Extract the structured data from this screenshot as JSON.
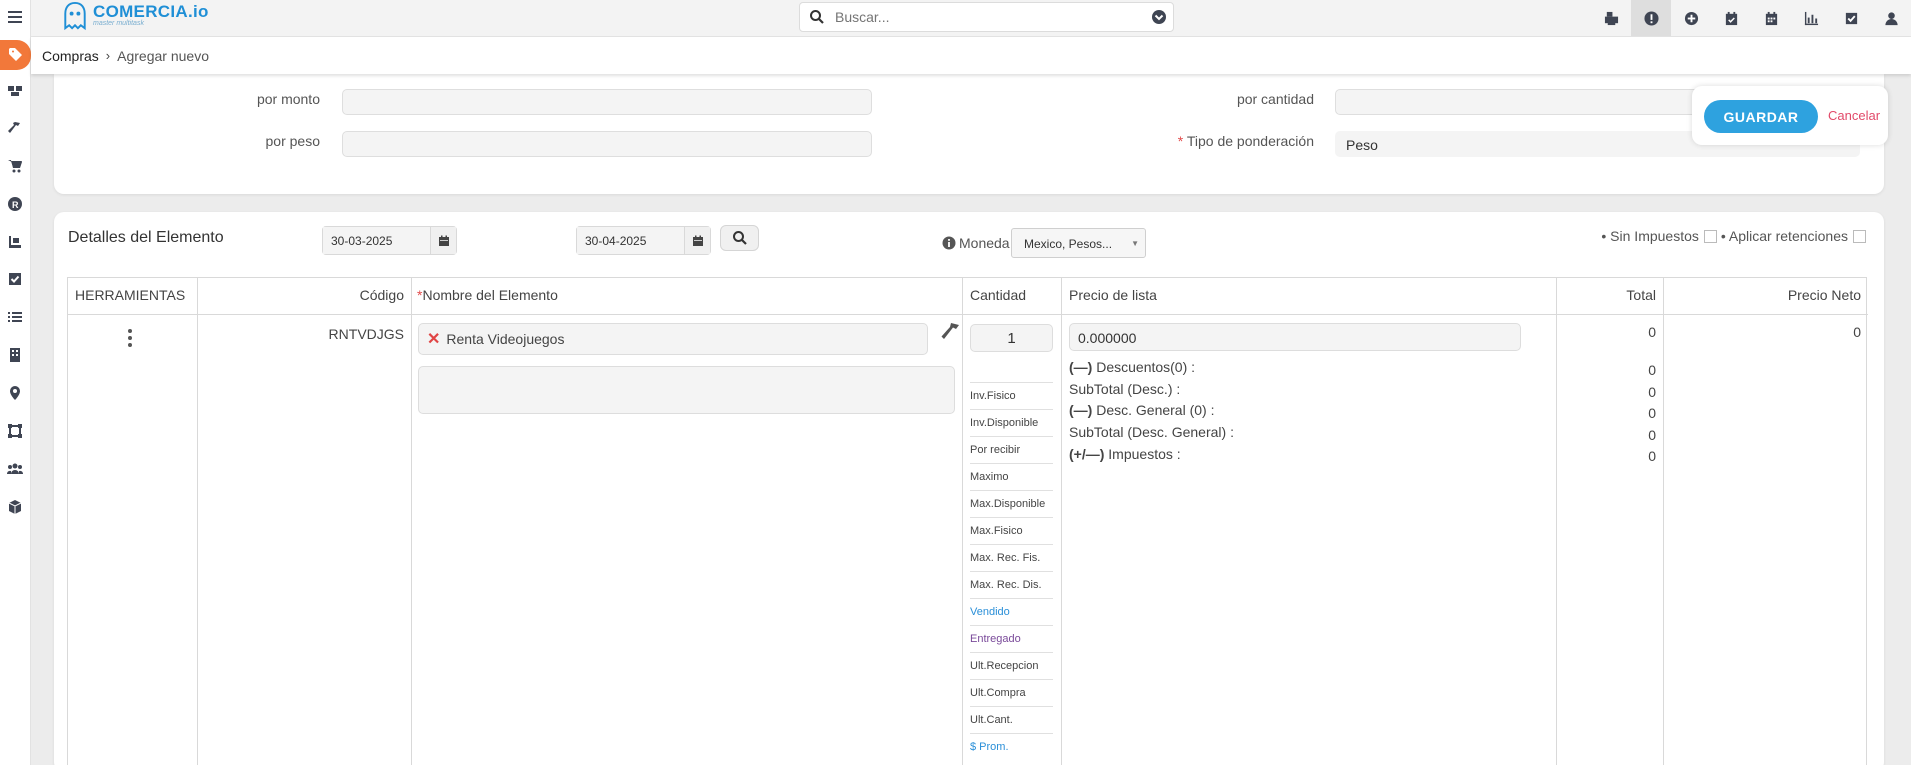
{
  "app": {
    "brand": "COMERCIA.io",
    "tagline": "master multitask"
  },
  "search": {
    "placeholder": "Buscar..."
  },
  "topbar_icons": [
    "printer-icon",
    "alert-icon",
    "plus-circle-icon",
    "calendar-check-icon",
    "calendar-icon",
    "chart-icon",
    "check-square-icon",
    "user-icon"
  ],
  "sidebar_icons": [
    "tags-icon",
    "boxes-icon",
    "hammer-icon",
    "cart-icon",
    "r-circle-icon",
    "dolly-icon",
    "check-square-icon",
    "list-icon",
    "building-icon",
    "map-pin-icon",
    "vector-square-icon",
    "users-icon",
    "cube-icon"
  ],
  "breadcrumb": {
    "parent": "Compras",
    "current": "Agregar nuevo"
  },
  "form": {
    "por_monto": {
      "label": "por monto",
      "value": ""
    },
    "por_peso": {
      "label": "por peso",
      "value": ""
    },
    "por_cantidad": {
      "label": "por cantidad",
      "value": ""
    },
    "tipo_ponderacion": {
      "label": "Tipo de ponderación",
      "required": "*",
      "value": "Peso"
    }
  },
  "actions": {
    "save": "GUARDAR",
    "cancel": "Cancelar"
  },
  "details": {
    "title": "Detalles del Elemento",
    "date_from": "30-03-2025",
    "date_to": "30-04-2025",
    "moneda_label": "Moneda",
    "moneda_value": "Mexico, Pesos...",
    "sin_impuestos": "• Sin Impuestos",
    "aplicar_retenciones": "• Aplicar retenciones"
  },
  "table": {
    "headers": {
      "herramientas": "HERRAMIENTAS",
      "codigo": "Código",
      "nombre_req": "*",
      "nombre": "Nombre del Elemento",
      "cantidad": "Cantidad",
      "precio": "Precio de lista",
      "total": "Total",
      "precio_neto": "Precio Neto"
    },
    "row": {
      "codigo": "RNTVDJGS",
      "nombre": "Renta Videojuegos",
      "cantidad": "1",
      "precio_lista": "0.000000",
      "total": "0",
      "precio_neto": "0",
      "inventory": [
        "Inv.Fisico",
        "Inv.Disponible",
        "Por recibir",
        "Maximo",
        "Max.Disponible",
        "Max.Fisico",
        "Max. Rec. Fis.",
        "Max. Rec. Dis.",
        "Vendido",
        "Entregado",
        "Ult.Recepcion",
        "Ult.Compra",
        "Ult.Cant.",
        "$ Prom."
      ],
      "breakdown": [
        {
          "sym": "(—)",
          "label": "Descuentos(0) :",
          "value": "0"
        },
        {
          "sym": "",
          "label": "SubTotal (Desc.) :",
          "value": "0"
        },
        {
          "sym": "(—)",
          "label": "Desc. General (0) :",
          "value": "0"
        },
        {
          "sym": "",
          "label": "SubTotal (Desc. General) :",
          "value": "0"
        },
        {
          "sym": "(+/—)",
          "label": "Impuestos :",
          "value": "0"
        }
      ]
    }
  },
  "colors": {
    "accent": "#2ea2df",
    "sidebar_active": "#f2783a",
    "cancel": "#e24a6a"
  }
}
